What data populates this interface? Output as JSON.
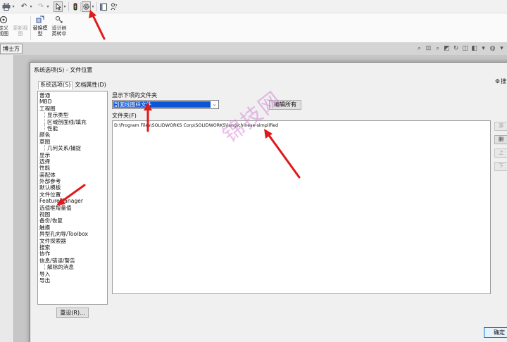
{
  "ribbon": {
    "buttons": [
      {
        "label": "定义\n视图",
        "icon": "view-orientation-icon",
        "disabled": false
      },
      {
        "label": "更新视\n图",
        "icon": "update-view-icon",
        "disabled": true
      },
      {
        "label": "替换模\n型",
        "icon": "replace-model-icon",
        "disabled": false
      },
      {
        "label": "设计树\n英转中",
        "icon": "design-tree-translate-icon",
        "disabled": false
      }
    ]
  },
  "tabstrip": {
    "left_tab": "博士方通"
  },
  "dialog": {
    "title": "系统选项(S) - 文件位置",
    "tabs": [
      "系统选项(S)",
      "文档属性(D)"
    ],
    "search_label": "搜",
    "tree": [
      {
        "label": "普通",
        "level": 0
      },
      {
        "label": "MBD",
        "level": 0
      },
      {
        "label": "工程图",
        "level": 0
      },
      {
        "label": "显示类型",
        "level": 1
      },
      {
        "label": "区域剖面线/填充",
        "level": 1
      },
      {
        "label": "性能",
        "level": 1
      },
      {
        "label": "颜色",
        "level": 0
      },
      {
        "label": "草图",
        "level": 0
      },
      {
        "label": "几何关系/捕捉",
        "level": 1
      },
      {
        "label": "显示",
        "level": 0
      },
      {
        "label": "选择",
        "level": 0
      },
      {
        "label": "性能",
        "level": 0
      },
      {
        "label": "装配体",
        "level": 0
      },
      {
        "label": "外部参考",
        "level": 0
      },
      {
        "label": "默认模板",
        "level": 0
      },
      {
        "label": "文件位置",
        "level": 0
      },
      {
        "label": "FeatureManager",
        "level": 0
      },
      {
        "label": "选值框增量值",
        "level": 0
      },
      {
        "label": "视图",
        "level": 0
      },
      {
        "label": "备份/恢复",
        "level": 0
      },
      {
        "label": "触摸",
        "level": 0
      },
      {
        "label": "异型孔向导/Toolbox",
        "level": 0
      },
      {
        "label": "文件探索器",
        "level": 0
      },
      {
        "label": "搜索",
        "level": 0
      },
      {
        "label": "协作",
        "level": 0
      },
      {
        "label": "信息/错误/警告",
        "level": 0
      },
      {
        "label": "解除的消息",
        "level": 1
      },
      {
        "label": "导入",
        "level": 0
      },
      {
        "label": "导出",
        "level": 0
      }
    ],
    "reset_button": "重设(R)...",
    "show_folders_label": "显示下项的文件夹",
    "show_folders_value": "剖面线图样文件",
    "edit_all_button": "编辑所有",
    "folders_label": "文件夹(F)",
    "folder_paths": [
      "D:\\Program Files\\SOLIDWORKS Corp\\SOLIDWORKS\\lang\\chinese-simplified"
    ],
    "side_buttons": [
      {
        "label": "添",
        "enabled": false
      },
      {
        "label": "删",
        "enabled": true
      },
      {
        "label": "上",
        "enabled": false
      },
      {
        "label": "下",
        "enabled": false
      }
    ],
    "ok_button": "确定"
  },
  "watermark": "锦技网",
  "colors": {
    "selection": "#0a54d8",
    "annotation_arrow": "#e0191b",
    "watermark": "#ce70ce"
  }
}
